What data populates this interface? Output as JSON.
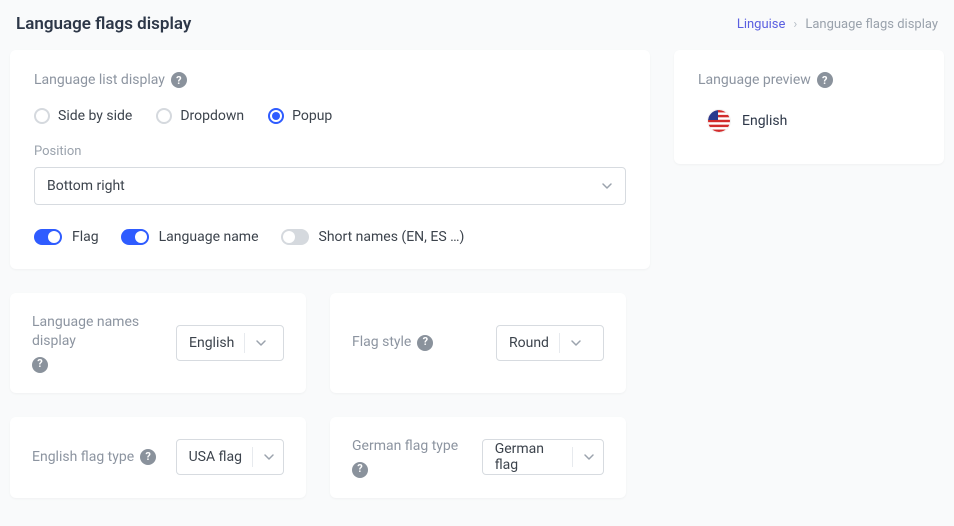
{
  "header": {
    "title": "Language flags display",
    "breadcrumb_link": "Linguise",
    "breadcrumb_current": "Language flags display"
  },
  "list_display": {
    "section_label": "Language list display",
    "options": [
      "Side by side",
      "Dropdown",
      "Popup"
    ],
    "selected_index": 2
  },
  "position": {
    "label": "Position",
    "value": "Bottom right"
  },
  "toggles": {
    "flag": {
      "label": "Flag",
      "on": true
    },
    "language_name": {
      "label": "Language name",
      "on": true
    },
    "short_names": {
      "label": "Short names (EN, ES …)",
      "on": false
    }
  },
  "cards": {
    "names_display": {
      "label": "Language names display",
      "value": "English"
    },
    "flag_style": {
      "label": "Flag style",
      "value": "Round"
    },
    "english_flag": {
      "label": "English flag type",
      "value": "USA flag"
    },
    "german_flag": {
      "label": "German flag type",
      "value": "German flag"
    }
  },
  "preview": {
    "section_label": "Language preview",
    "language": "English"
  }
}
